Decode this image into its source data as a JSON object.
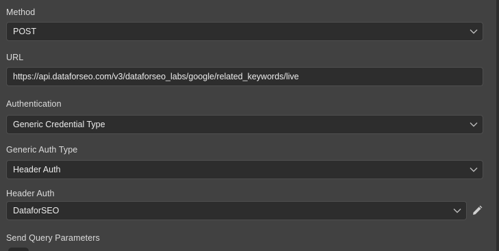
{
  "method": {
    "label": "Method",
    "value": "POST"
  },
  "url": {
    "label": "URL",
    "value": "https://api.dataforseo.com/v3/dataforseo_labs/google/related_keywords/live"
  },
  "authentication": {
    "label": "Authentication",
    "value": "Generic Credential Type"
  },
  "generic_auth_type": {
    "label": "Generic Auth Type",
    "value": "Header Auth"
  },
  "header_auth": {
    "label": "Header Auth",
    "value": "DataforSEO"
  },
  "send_query_parameters": {
    "label": "Send Query Parameters"
  },
  "icons": {
    "dropdown": "chevron-down-icon",
    "edit": "pencil-icon"
  },
  "colors": {
    "background": "#414141",
    "field_background": "#2d2d2d",
    "field_border": "#4f4f4f",
    "text": "#ececec"
  }
}
